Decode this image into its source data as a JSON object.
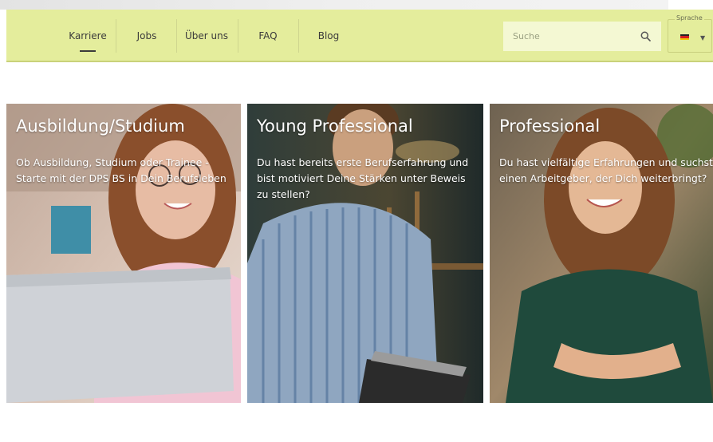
{
  "nav": {
    "items": [
      {
        "label": "Karriere",
        "active": true
      },
      {
        "label": "Jobs",
        "active": false
      },
      {
        "label": "Über uns",
        "active": false
      },
      {
        "label": "FAQ",
        "active": false
      },
      {
        "label": "Blog",
        "active": false
      }
    ],
    "search_placeholder": "Suche",
    "language_label": "Sprache",
    "language_flag": "german-flag-icon"
  },
  "colors": {
    "nav_background": "#e4ed9c",
    "search_background": "#f4f8d3"
  },
  "cards": [
    {
      "title": "Ausbildung/Studium",
      "text": "Ob Ausbildung, Studium oder Trainee - Starte mit der DPS BS in Dein Berufsleben"
    },
    {
      "title": "Young Professional",
      "text": "Du hast bereits erste Berufserfahrung und bist motiviert Deine Stärken unter Beweis zu stellen?"
    },
    {
      "title": "Professional",
      "text": "Du hast vielfältige Erfahrungen und suchst einen Arbeitgeber, der Dich weiterbringt?"
    }
  ]
}
